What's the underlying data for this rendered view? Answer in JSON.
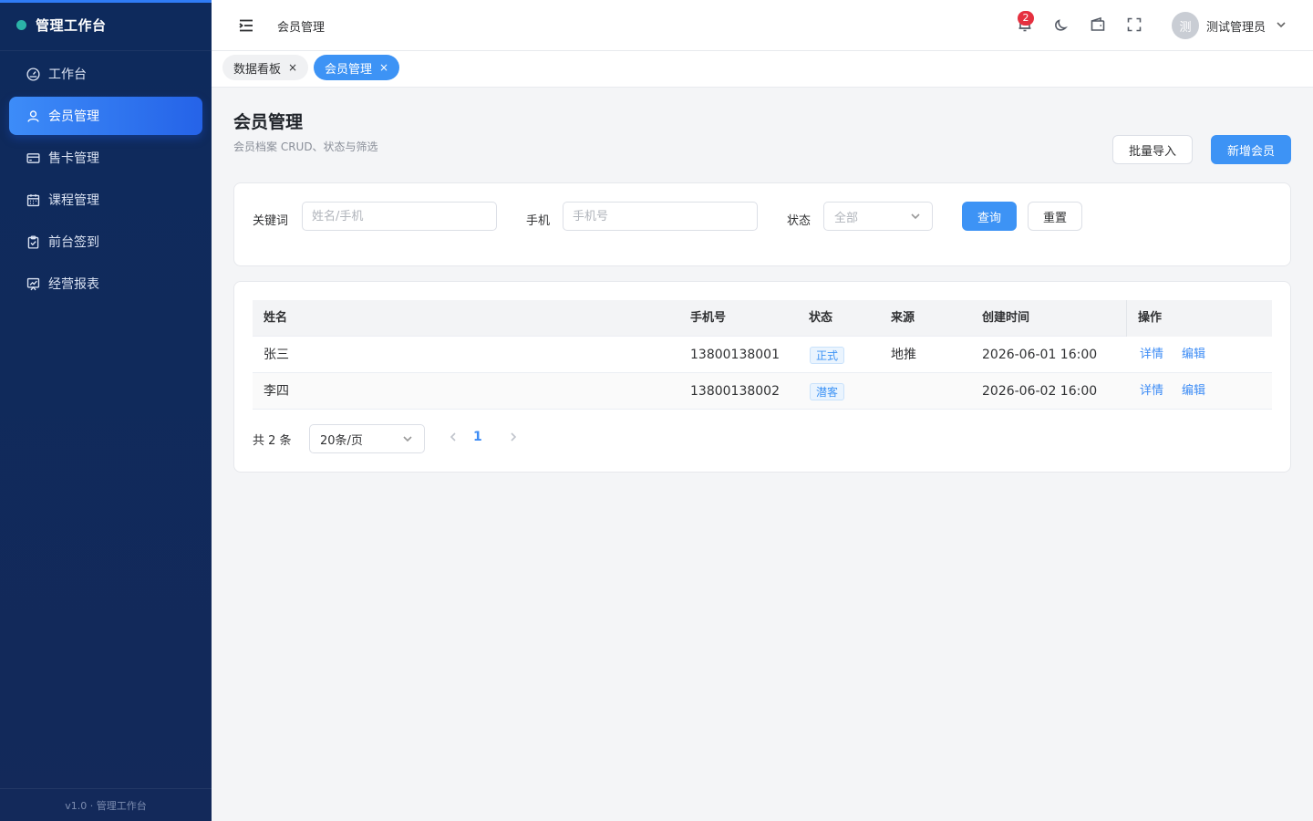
{
  "sidebar": {
    "brand": "管理工作台",
    "items": [
      {
        "label": "工作台",
        "icon": "dashboard-icon"
      },
      {
        "label": "会员管理",
        "icon": "user-icon"
      },
      {
        "label": "售卡管理",
        "icon": "card-icon"
      },
      {
        "label": "课程管理",
        "icon": "calendar-icon"
      },
      {
        "label": "前台签到",
        "icon": "clipboard-check-icon"
      },
      {
        "label": "经营报表",
        "icon": "chart-icon"
      }
    ],
    "active_item": "会员管理",
    "footer": "v1.0 · 管理工作台"
  },
  "header": {
    "breadcrumb": "会员管理",
    "notification_count": "2",
    "user_avatar_text": "测",
    "user_name": "测试管理员"
  },
  "tabs": [
    {
      "label": "数据看板",
      "close": "×"
    },
    {
      "label": "会员管理",
      "close": "×"
    }
  ],
  "page": {
    "title": "会员管理",
    "subtitle": "会员档案 CRUD、状态与筛选",
    "import_button": "批量导入",
    "add_button": "新增会员"
  },
  "filters": {
    "keyword_label": "关键词",
    "keyword_placeholder": "姓名/手机",
    "phone_label": "手机",
    "phone_placeholder": "手机号",
    "status_label": "状态",
    "status_value": "全部",
    "search_button": "查询",
    "reset_button": "重置"
  },
  "table": {
    "columns": [
      "姓名",
      "手机号",
      "状态",
      "来源",
      "创建时间",
      "操作"
    ],
    "rows": [
      {
        "name": "张三",
        "phone": "13800138001",
        "status": "正式",
        "source": "地推",
        "created": "2026-06-01 16:00",
        "detail": "详情",
        "edit": "编辑"
      },
      {
        "name": "李四",
        "phone": "13800138002",
        "status": "潜客",
        "source": "",
        "created": "2026-06-02 16:00",
        "detail": "详情",
        "edit": "编辑"
      }
    ]
  },
  "pagination": {
    "total": "共 2 条",
    "page_size": "20条/页",
    "current_page": "1"
  },
  "colors": {
    "sidebar_bg": "#0e2a5c",
    "accent": "#3d93f5",
    "badge": "#e5303f"
  }
}
